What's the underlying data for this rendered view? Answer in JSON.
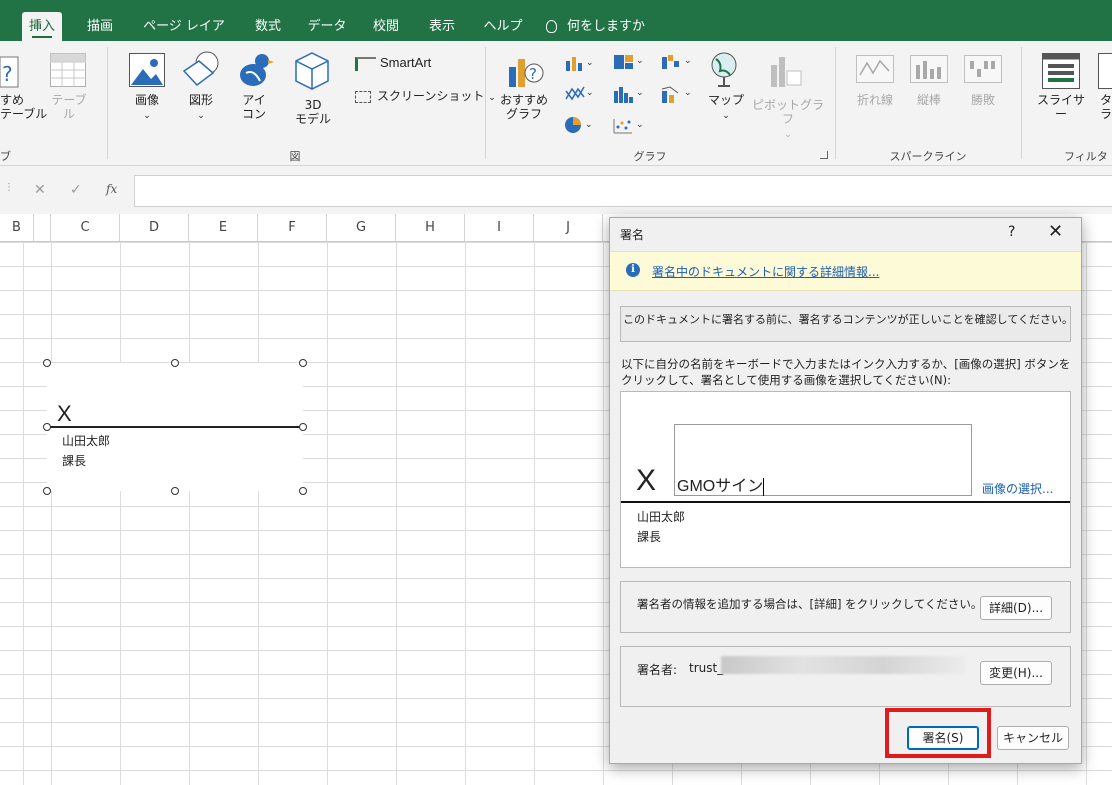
{
  "ribbon_tabs": [
    "挿入",
    "描画",
    "ページ レイアウト",
    "数式",
    "データ",
    "校閲",
    "表示",
    "ヘルプ",
    "何をしますか"
  ],
  "ribbon": {
    "tables_partial": {
      "recommended": "すめ\nテーブル",
      "table": "テーブル",
      "group": "ブル"
    },
    "illustrations": {
      "image": "画像",
      "shapes": "図形",
      "icons": "アイ\nコン",
      "model3d": "3D\nモデル",
      "smartart": "SmartArt",
      "screenshot": "スクリーンショット",
      "group": "図"
    },
    "charts": {
      "recommended": "おすすめ\nグラフ",
      "map": "マップ",
      "pivot": "ピボットグラフ",
      "group": "グラフ"
    },
    "sparklines": {
      "line": "折れ線",
      "column": "縦棒",
      "winloss": "勝敗",
      "group": "スパークライン"
    },
    "filters": {
      "slicer": "スライサー",
      "timeline_partial": "タイ\nライ",
      "group": "フィルター"
    }
  },
  "formula_bar": {
    "cancel": "✕",
    "enter": "✓",
    "fx": "fx",
    "value": ""
  },
  "columns": [
    "B",
    "C",
    "D",
    "E",
    "F",
    "G",
    "H",
    "I",
    "J"
  ],
  "sheet_signature": {
    "x": "X",
    "name": "山田太郎",
    "title": "課長"
  },
  "dialog": {
    "title": "署名",
    "help": "?",
    "close": "✕",
    "info_link": "署名中のドキュメントに関する詳細情報...",
    "verify_text": "このドキュメントに署名する前に、署名するコンテンツが正しいことを確認してください。",
    "instructions": "以下に自分の名前をキーボードで入力またはインク入力するか、[画像の選択] ボタンをクリックして、署名として使用する画像を選択してください(N):",
    "x_mark": "X",
    "signature_input": "GMOサイン",
    "select_image": "画像の選択...",
    "signer_name": "山田太郎",
    "signer_title": "課長",
    "details_text": "署名者の情報を追加する場合は、[詳細] をクリックしてください。",
    "details_button": "詳細(D)...",
    "signer_label": "署名者:",
    "signer_value": "trust_",
    "change_button": "変更(H)...",
    "sign_button": "署名(S)",
    "cancel_button": "キャンセル"
  }
}
